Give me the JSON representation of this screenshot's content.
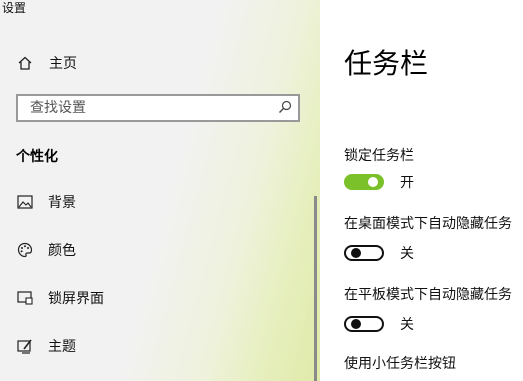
{
  "app_title": "设置",
  "sidebar": {
    "home_label": "主页",
    "search_placeholder": "查找设置",
    "section_title": "个性化",
    "items": [
      {
        "label": "背景",
        "icon": "image-icon"
      },
      {
        "label": "颜色",
        "icon": "palette-icon"
      },
      {
        "label": "锁屏界面",
        "icon": "lock-screen-icon"
      },
      {
        "label": "主题",
        "icon": "theme-brush-icon"
      }
    ]
  },
  "main": {
    "title": "任务栏",
    "settings": [
      {
        "label": "锁定任务栏",
        "state_text": "开",
        "on": true
      },
      {
        "label": "在桌面模式下自动隐藏任务",
        "state_text": "关",
        "on": false
      },
      {
        "label": "在平板模式下自动隐藏任务",
        "state_text": "关",
        "on": false
      },
      {
        "label": "使用小任务栏按钮"
      }
    ]
  },
  "colors": {
    "accent": "#7bc12a",
    "sidebar_bg": "#f2f2f2"
  }
}
